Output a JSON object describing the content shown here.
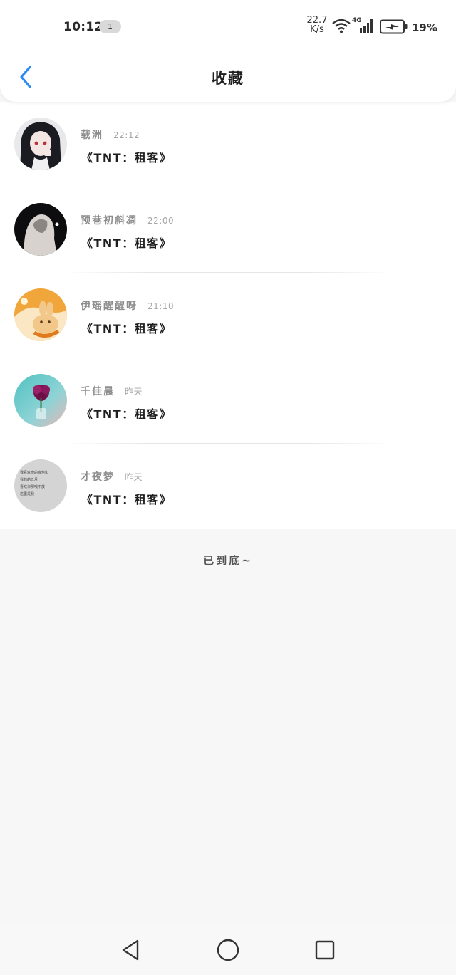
{
  "status_bar": {
    "time": "10:12",
    "notification_count": "1",
    "net_speed_value": "22.7",
    "net_speed_unit": "K/s",
    "signal_type": "4G",
    "battery_percent": "19%"
  },
  "header": {
    "title": "收藏",
    "accent_color": "#2d8cf0"
  },
  "favorites": [
    {
      "name": "载洲",
      "time": "22:12",
      "title": "《TNT：租客》",
      "avatar": "anime-girl-avatar"
    },
    {
      "name": "预巷初斜凋",
      "time": "22:00",
      "title": "《TNT：租客》",
      "avatar": "hooded-figure-avatar"
    },
    {
      "name": "伊瑶醒醒呀",
      "time": "21:10",
      "title": "《TNT：租客》",
      "avatar": "cartoon-bunny-avatar"
    },
    {
      "name": "千佳晨",
      "time": "昨天",
      "title": "《TNT：租客》",
      "avatar": "flower-vase-avatar"
    },
    {
      "name": "才夜梦",
      "time": "昨天",
      "title": "《TNT：租客》",
      "avatar": "text-note-avatar"
    }
  ],
  "avatar_note_lines": [
    "我喜欢晚的夜色和",
    "我的的氏月",
    "喜欢你那哦不放",
    "这里是我"
  ],
  "footer": {
    "end_text": "已到底~"
  },
  "nav_bar": {
    "icons": [
      "back-triangle-icon",
      "home-circle-icon",
      "recents-square-icon"
    ]
  }
}
